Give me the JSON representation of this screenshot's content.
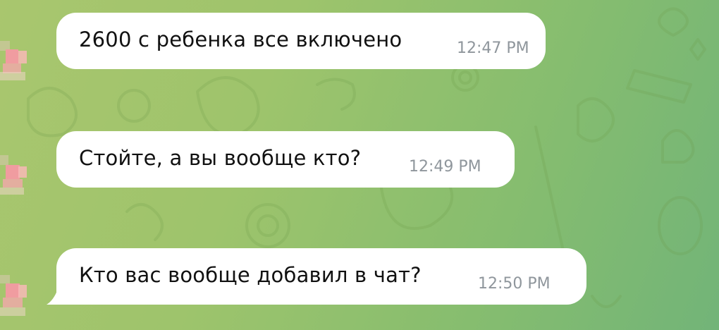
{
  "chat": {
    "messages": [
      {
        "text": "2600 с ребенка все включено",
        "time": "12:47 PM"
      },
      {
        "text": "Стойте, а вы вообще кто?",
        "time": "12:49 PM"
      },
      {
        "text": "Кто вас вообще добавил в чат?",
        "time": "12:50 PM"
      }
    ]
  },
  "colors": {
    "bubble": "#ffffff",
    "text": "#111111",
    "time": "#8f969c",
    "wallpaper_start": "#a9c66e",
    "wallpaper_end": "#72b478",
    "avatar_blur": "#f2a6a8"
  }
}
